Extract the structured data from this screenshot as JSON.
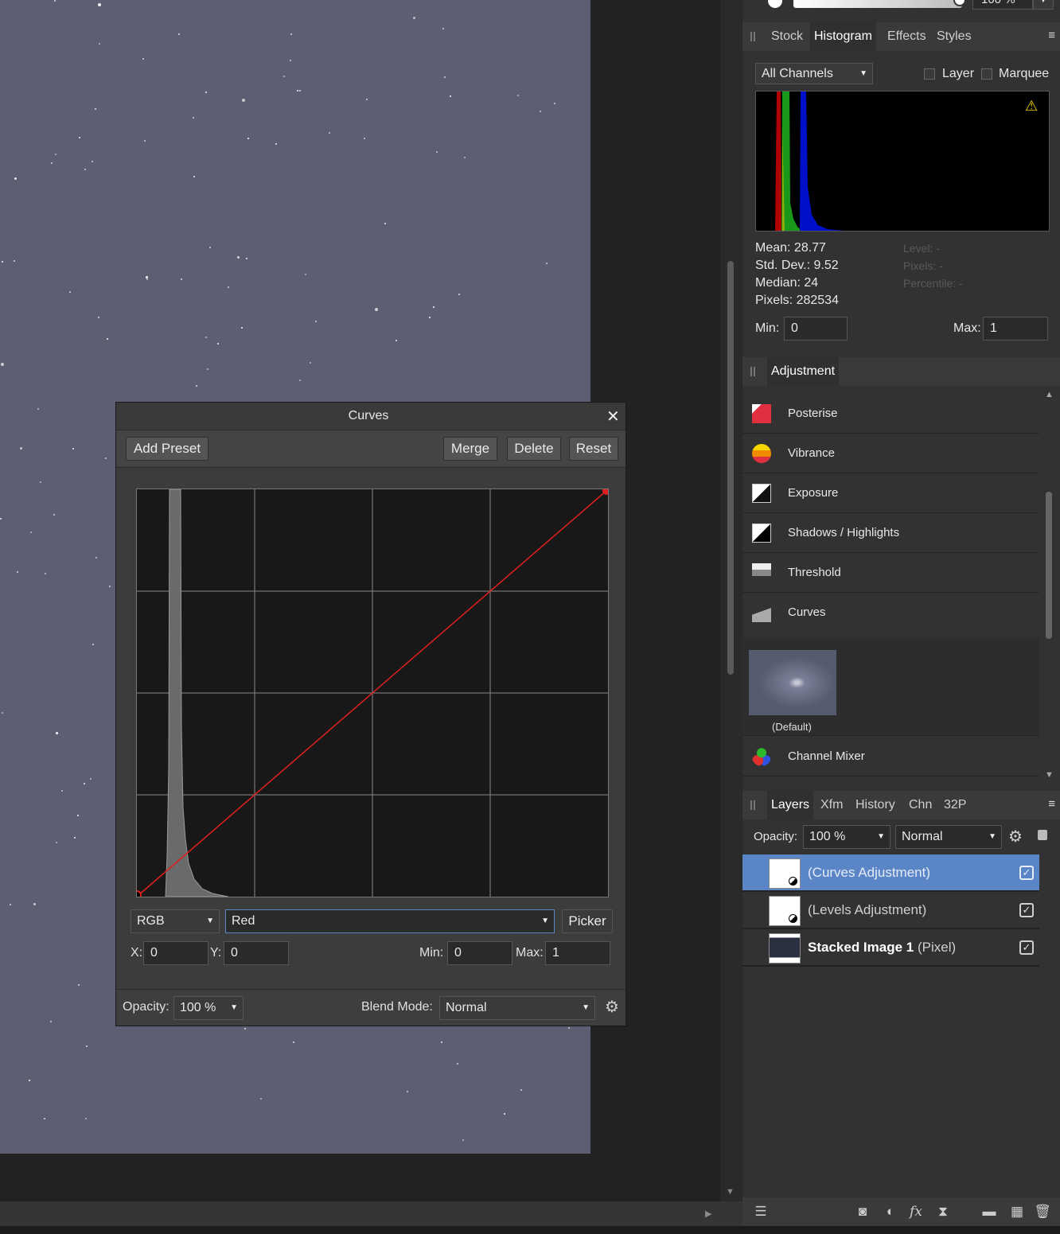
{
  "top_bar": {
    "opacity_value": "100 %"
  },
  "studio_tabs": [
    "Stock",
    "Histogram",
    "Effects",
    "Styles"
  ],
  "histogram": {
    "channel": "All Channels",
    "layer_label": "Layer",
    "marquee_label": "Marquee",
    "mean": "Mean: 28.77",
    "std_dev": "Std. Dev.: 9.52",
    "median": "Median: 24",
    "pixels": "Pixels: 282534",
    "level": "Level: -",
    "pixels_hover": "Pixels: -",
    "percentile": "Percentile: -",
    "min_label": "Min:",
    "min_value": "0",
    "max_label": "Max:",
    "max_value": "1",
    "warning_icon": "warning-icon"
  },
  "adjustment": {
    "tab": "Adjustment",
    "items": [
      {
        "label": "Posterise",
        "icon": "posterise-icon"
      },
      {
        "label": "Vibrance",
        "icon": "vibrance-icon"
      },
      {
        "label": "Exposure",
        "icon": "exposure-icon"
      },
      {
        "label": "Shadows / Highlights",
        "icon": "shadows-highlights-icon"
      },
      {
        "label": "Threshold",
        "icon": "threshold-icon"
      },
      {
        "label": "Curves",
        "icon": "curves-icon"
      }
    ],
    "preset_label": "(Default)",
    "channel_mixer": "Channel Mixer"
  },
  "layers_tabs": [
    "Layers",
    "Xfm",
    "History",
    "Chn",
    "32P"
  ],
  "layers": {
    "opacity_label": "Opacity:",
    "opacity_value": "100 %",
    "blend_mode": "Normal",
    "rows": [
      {
        "name": "(Curves Adjustment)",
        "suffix": "",
        "selected": true
      },
      {
        "name": "(Levels Adjustment)",
        "suffix": "",
        "selected": false
      },
      {
        "name": "Stacked Image 1",
        "suffix": "(Pixel)",
        "selected": false
      }
    ]
  },
  "curves_dialog": {
    "title": "Curves",
    "add_preset": "Add Preset",
    "merge": "Merge",
    "delete": "Delete",
    "reset": "Reset",
    "colour_space": "RGB",
    "channel": "Red",
    "picker": "Picker",
    "x_label": "X:",
    "x_value": "0",
    "y_label": "Y:",
    "y_value": "0",
    "min_label": "Min:",
    "min_value": "0",
    "max_label": "Max:",
    "max_value": "1",
    "opacity_label": "Opacity:",
    "opacity_value": "100 %",
    "blend_label": "Blend Mode:",
    "blend_value": "Normal",
    "curve_points": [
      [
        0,
        0
      ],
      [
        1,
        1
      ]
    ],
    "curve_color": "#e02020"
  },
  "colors": {
    "accent_selected": "#5a86c8",
    "canvas_photo": "#5b5f71"
  }
}
